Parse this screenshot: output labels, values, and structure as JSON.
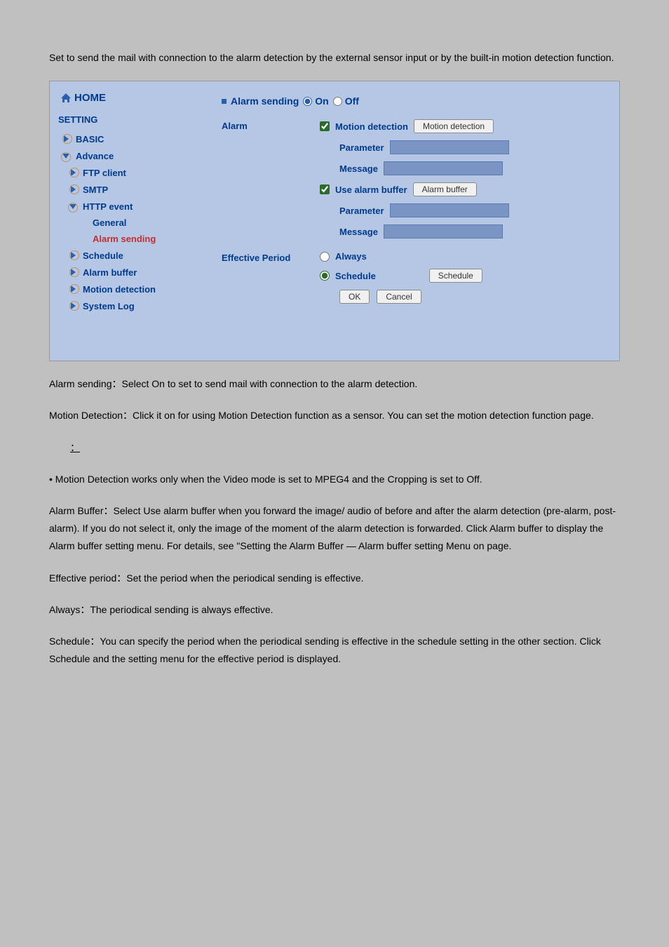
{
  "intro_paragraph": "Set to send the mail with connection to the alarm detection by the external sensor input or by the built-in motion detection function.",
  "sidebar": {
    "home": "HOME",
    "setting": "SETTING",
    "basic": "BASIC",
    "advance": "Advance",
    "ftp_client": "FTP client",
    "smtp": "SMTP",
    "http_event": "HTTP event",
    "general": "General",
    "alarm_sending": "Alarm sending",
    "schedule": "Schedule",
    "alarm_buffer": "Alarm buffer",
    "motion_detection": "Motion detection",
    "system_log": "System Log"
  },
  "panel": {
    "title": "Alarm sending",
    "on": "On",
    "off": "Off",
    "alarm_label": "Alarm",
    "motion_detection": "Motion detection",
    "motion_detection_btn": "Motion detection",
    "parameter": "Parameter",
    "message": "Message",
    "use_alarm_buffer": "Use alarm buffer",
    "alarm_buffer_btn": "Alarm buffer",
    "effective_period": "Effective Period",
    "always": "Always",
    "schedule": "Schedule",
    "schedule_btn": "Schedule",
    "ok": "OK",
    "cancel": "Cancel"
  },
  "desc": {
    "alarm_sending": "Alarm sending：Select On to set to send mail with connection to the alarm detection.",
    "motion_detection": "Motion Detection：Click it on for using Motion Detection function as a sensor. You can set the motion detection function page.",
    "note_label": "：",
    "note_bullet": "• Motion Detection works only when the Video mode is set to MPEG4 and the Cropping is set to Off.",
    "alarm_buffer": "Alarm Buffer：Select Use alarm buffer when you forward the image/ audio of before and after the alarm detection (pre-alarm, post-alarm). If you do not select it, only the image of the moment of the alarm detection is forwarded. Click Alarm buffer to display the Alarm buffer setting menu. For details, see \"Setting the Alarm Buffer — Alarm buffer setting Menu on page.",
    "effective_period": "Effective period：Set the period when the periodical sending is effective.",
    "always": "Always：The periodical sending is always effective.",
    "schedule": "Schedule：You can specify the period when the periodical sending is effective in the schedule setting in the other section. Click Schedule and the setting menu for the effective period is displayed."
  }
}
